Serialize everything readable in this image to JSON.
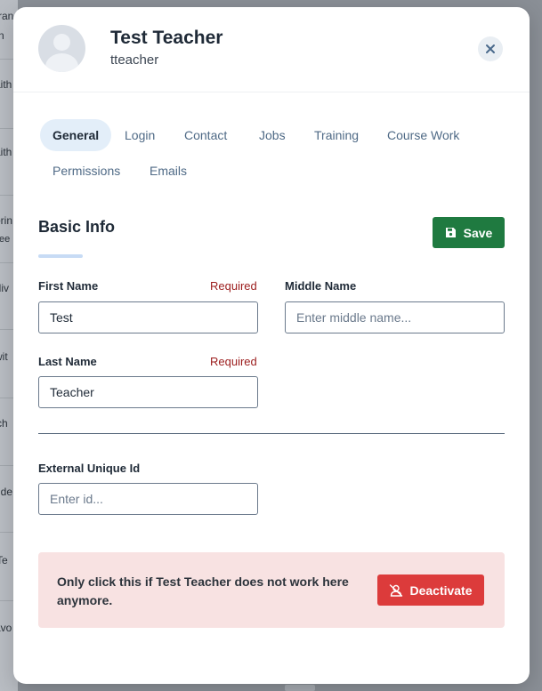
{
  "background": {
    "fragments": [
      "ran",
      "n",
      "aith",
      "aith",
      "orin",
      "tee",
      "lliv",
      "wit",
      "ch",
      "dde",
      "Te",
      "avo"
    ]
  },
  "header": {
    "user_name": "Test Teacher",
    "user_login": "tteacher",
    "close_icon": "close-icon"
  },
  "tabs": [
    {
      "label": "General",
      "active": true
    },
    {
      "label": "Login",
      "active": false
    },
    {
      "label": "Contact",
      "active": false
    },
    {
      "label": "Jobs",
      "active": false
    },
    {
      "label": "Training",
      "active": false
    },
    {
      "label": "Course Work",
      "active": false
    },
    {
      "label": "Permissions",
      "active": false
    },
    {
      "label": "Emails",
      "active": false
    }
  ],
  "section": {
    "title": "Basic Info",
    "save_label": "Save",
    "save_icon": "floppy-disk-icon"
  },
  "form": {
    "first_name": {
      "label": "First Name",
      "required": "Required",
      "value": "Test"
    },
    "middle_name": {
      "label": "Middle Name",
      "placeholder": "Enter middle name..."
    },
    "last_name": {
      "label": "Last Name",
      "required": "Required",
      "value": "Teacher"
    },
    "external_id": {
      "label": "External Unique Id",
      "placeholder": "Enter id..."
    }
  },
  "deactivate": {
    "message": "Only click this if Test Teacher does not work here anymore.",
    "button_label": "Deactivate",
    "button_icon": "user-slash-icon"
  },
  "colors": {
    "save": "#1f7a40",
    "deactivate": "#dc3b3b",
    "warning_bg": "#f8e2e2",
    "required": "#9b1c1c",
    "active_tab": "#e3eef9"
  }
}
